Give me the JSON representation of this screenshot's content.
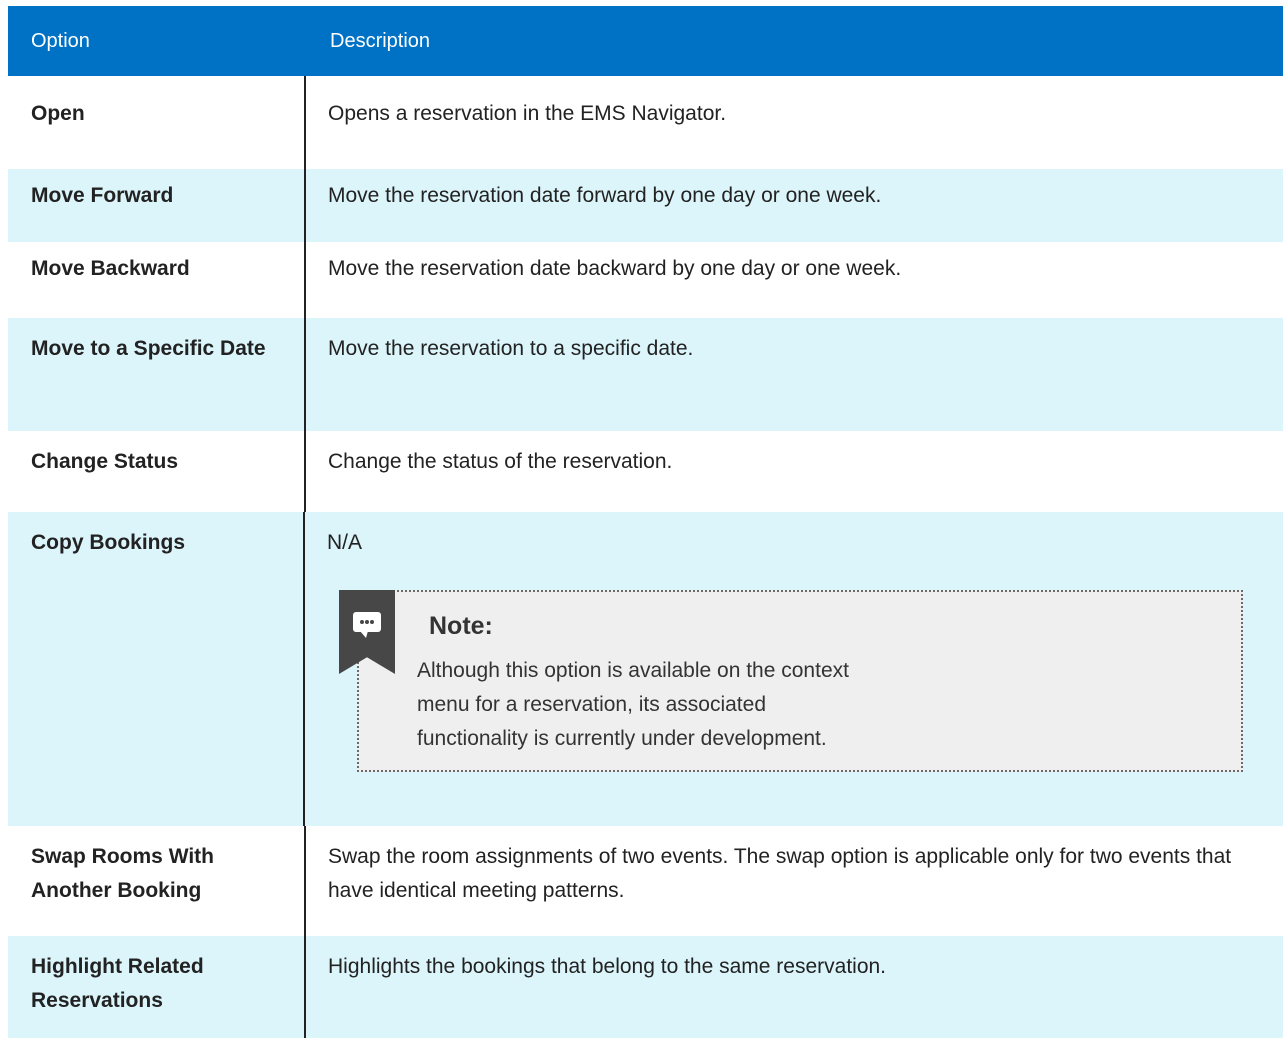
{
  "table": {
    "headers": {
      "option": "Option",
      "description": "Description"
    },
    "rows": [
      {
        "option": "Open",
        "description": "Opens a reservation in the EMS Navigator."
      },
      {
        "option": "Move Forward",
        "description": "Move the reservation date forward by one day or one week."
      },
      {
        "option": "Move Backward",
        "description": "Move the reservation date backward by one day or one week."
      },
      {
        "option": "Move to a Specific Date",
        "description": "Move the reservation to a specific date."
      },
      {
        "option": "Change Status",
        "description": "Change the status of the reservation."
      },
      {
        "option": "Copy Bookings",
        "description": "N/A"
      },
      {
        "option": "Swap Rooms With Another Booking",
        "description": "Swap the room assignments of two events. The swap option is applicable only for two events that have identical meeting patterns."
      },
      {
        "option": "Highlight Related Reservations",
        "description": "Highlights the bookings that belong to the same reservation."
      }
    ],
    "note": {
      "icon": "comment-icon",
      "title": "Note:",
      "body": "Although this option is available on the context menu for a reservation, its associated functionality is currently under development."
    }
  },
  "colors": {
    "header_bg": "#0072c6",
    "alt_row_bg": "#dbf5fb",
    "note_bg": "#efefef"
  }
}
